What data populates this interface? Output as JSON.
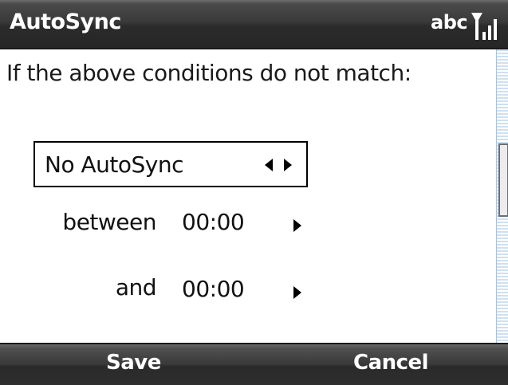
{
  "titlebar": {
    "title": "AutoSync",
    "input_mode": "abc"
  },
  "content": {
    "prompt": "If the above conditions do not match:",
    "picker": {
      "selected": "No AutoSync"
    },
    "rows": [
      {
        "label": "between",
        "value": "00:00"
      },
      {
        "label": "and",
        "value": "00:00"
      }
    ],
    "clipped_partial_text": "…"
  },
  "softkeys": {
    "left": "Save",
    "right": "Cancel"
  },
  "icons": {
    "signal": "signal-strength-icon",
    "picker_left": "arrow-left-icon",
    "picker_right": "arrow-right-icon",
    "row_arrow": "arrow-right-icon"
  },
  "colors": {
    "bar_dark": "#2b2b2b",
    "scroll_track": "#cfe0f0",
    "text": "#111111",
    "bar_text": "#ffffff"
  }
}
